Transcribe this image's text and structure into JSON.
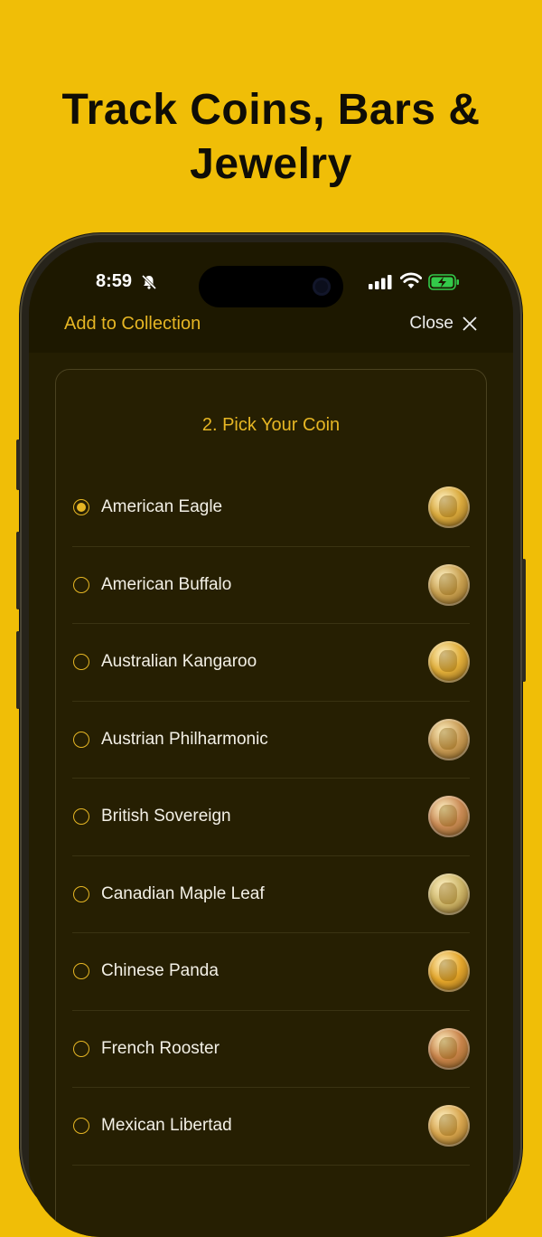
{
  "headline": [
    "Track Coins, Bars &",
    "Jewelry"
  ],
  "status_bar": {
    "time": "8:59"
  },
  "nav": {
    "title": "Add to Collection",
    "close_label": "Close"
  },
  "section_title": "2. Pick Your Coin",
  "accent_color": "#E6B624",
  "coins": [
    {
      "name": "American Eagle",
      "selected": true,
      "color": "#d9a93c"
    },
    {
      "name": "American Buffalo",
      "selected": false,
      "color": "#c8a050"
    },
    {
      "name": "Australian Kangaroo",
      "selected": false,
      "color": "#e0ad38"
    },
    {
      "name": "Austrian Philharmonic",
      "selected": false,
      "color": "#c89b55"
    },
    {
      "name": "British Sovereign",
      "selected": false,
      "color": "#c98a55"
    },
    {
      "name": "Canadian Maple Leaf",
      "selected": false,
      "color": "#cdb66a"
    },
    {
      "name": "Chinese Panda",
      "selected": false,
      "color": "#e3a52a"
    },
    {
      "name": "French Rooster",
      "selected": false,
      "color": "#c8834a"
    },
    {
      "name": "Mexican Libertad",
      "selected": false,
      "color": "#d7a54e"
    }
  ]
}
